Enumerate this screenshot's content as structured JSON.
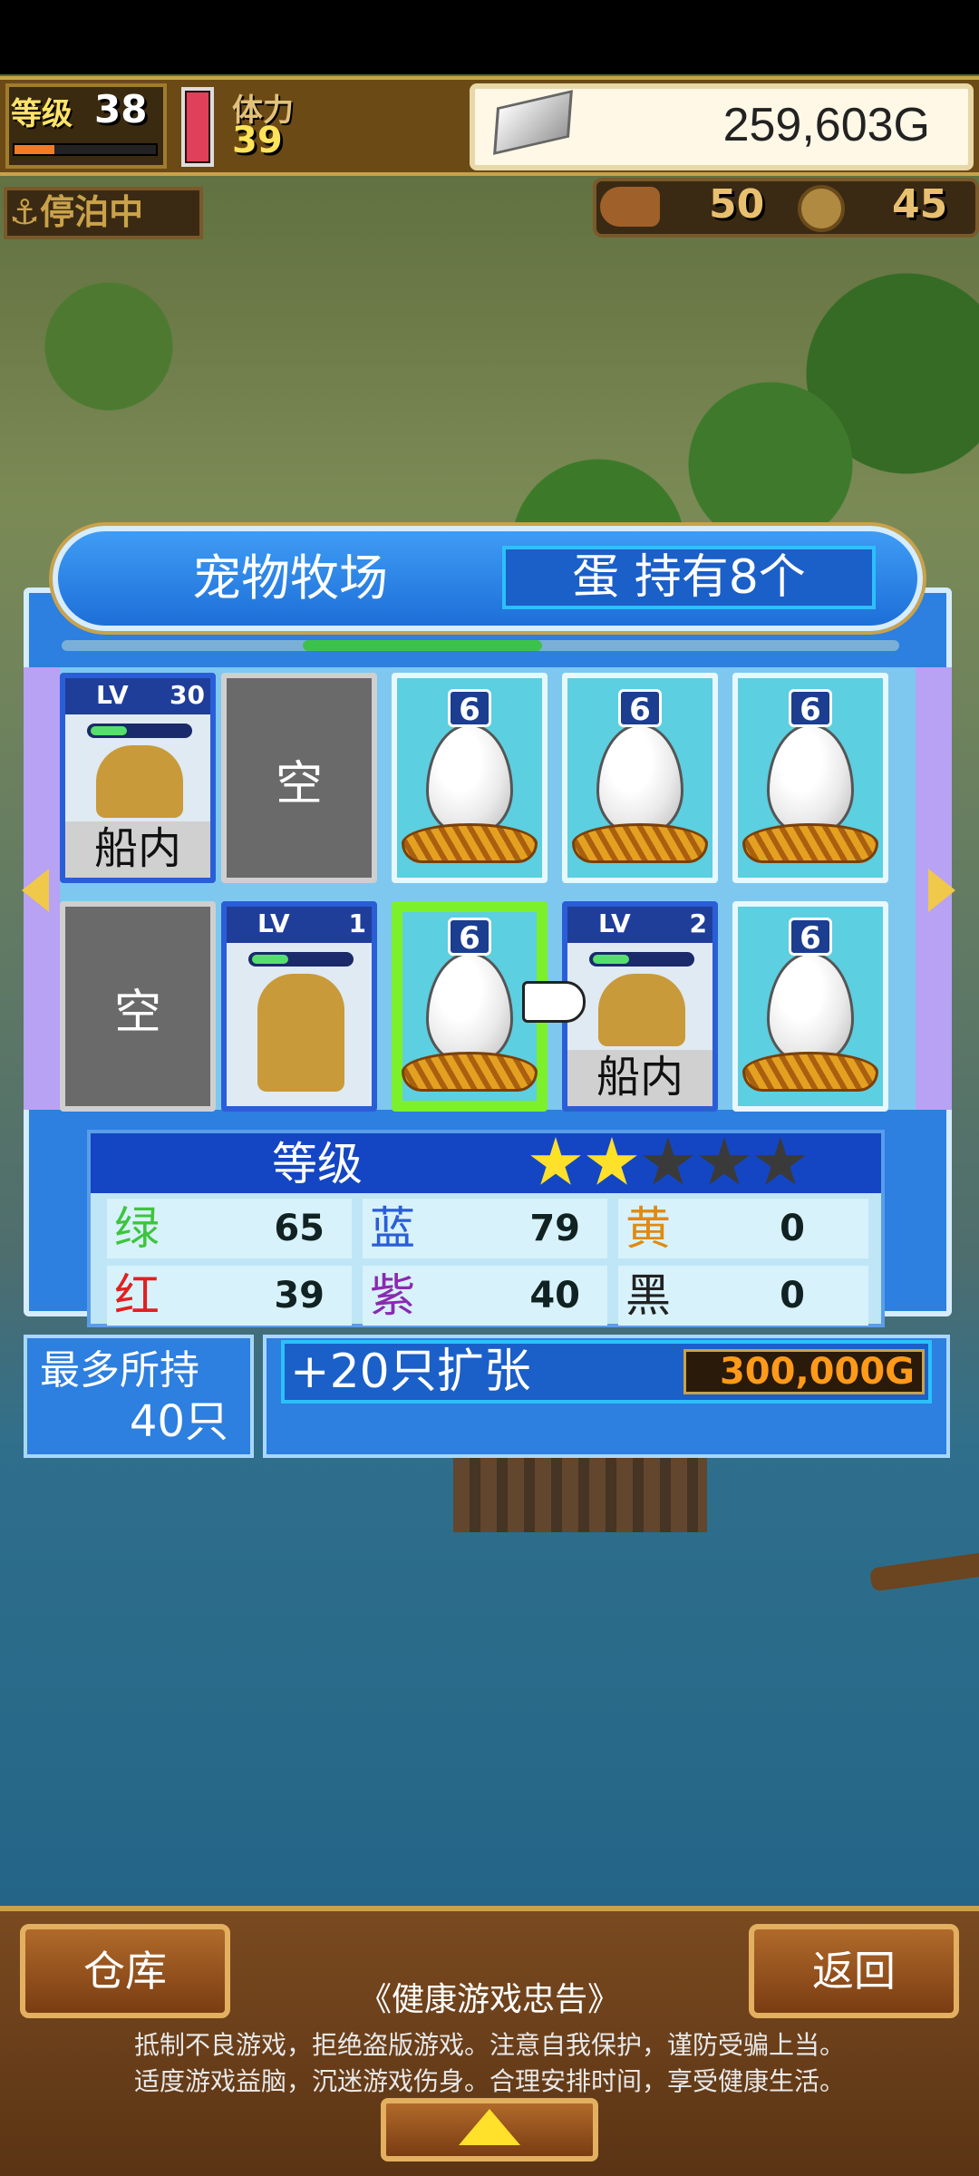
{
  "status": {
    "level_label": "等级",
    "level": "38",
    "exp_fraction": 0.28,
    "stamina_label": "体力",
    "stamina": "39",
    "money": "259,603G",
    "anchor_label": "⚓停泊中",
    "resource1": "50",
    "resource2": "45"
  },
  "ranch": {
    "title": "宠物牧场",
    "egg_count": "蛋 持有8个",
    "empty_label": "空",
    "aboard_label": "船内",
    "lv_tag": "LV",
    "slots_row1": [
      {
        "kind": "pet",
        "lv": "30",
        "aboard": true
      },
      {
        "kind": "empty"
      },
      {
        "kind": "egg",
        "num": "6"
      },
      {
        "kind": "egg",
        "num": "6"
      },
      {
        "kind": "egg",
        "num": "6"
      }
    ],
    "slots_row2": [
      {
        "kind": "empty"
      },
      {
        "kind": "pet",
        "lv": "1",
        "aboard": false
      },
      {
        "kind": "egg",
        "num": "6",
        "selected": true
      },
      {
        "kind": "pet",
        "lv": "2",
        "aboard": true
      },
      {
        "kind": "egg",
        "num": "6"
      }
    ]
  },
  "stats": {
    "grade_label": "等级",
    "stars_filled": 2,
    "stars_total": 5,
    "rows": [
      [
        {
          "name": "绿",
          "value": "65",
          "color": "#3ec43e"
        },
        {
          "name": "蓝",
          "value": "79",
          "color": "#2a5ed6"
        },
        {
          "name": "黄",
          "value": "0",
          "color": "#e08a10"
        }
      ],
      [
        {
          "name": "红",
          "value": "39",
          "color": "#e02020"
        },
        {
          "name": "紫",
          "value": "40",
          "color": "#8a2ab0"
        },
        {
          "name": "黑",
          "value": "0",
          "color": "#222222"
        }
      ]
    ]
  },
  "capacity": {
    "label": "最多所持",
    "value": "40只",
    "expand_label": "+20只扩张",
    "expand_price": "300,000G"
  },
  "bottom": {
    "warehouse": "仓库",
    "back": "返回",
    "notice_title": "《健康游戏忠告》",
    "notice_line1": "抵制不良游戏，拒绝盗版游戏。注意自我保护，谨防受骗上当。",
    "notice_line2": "适度游戏益脑，沉迷游戏伤身。合理安排时间，享受健康生活。"
  }
}
